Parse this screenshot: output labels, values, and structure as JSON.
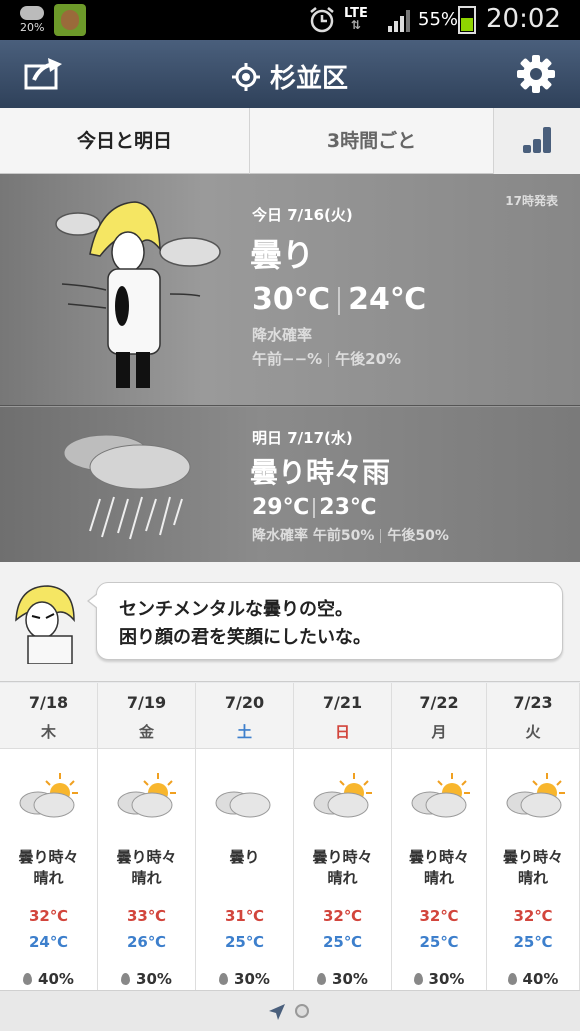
{
  "status_bar": {
    "weather_pct": "20%",
    "network": "LTE",
    "battery": "55%",
    "time": "20:02"
  },
  "header": {
    "location": "杉並区"
  },
  "tabs": [
    {
      "label": "今日と明日",
      "active": true
    },
    {
      "label": "3時間ごと",
      "active": false
    }
  ],
  "today": {
    "issued": "17時発表",
    "date": "今日 7/16(火)",
    "condition": "曇り",
    "high": "30℃",
    "low": "24℃",
    "precip_label": "降水確率",
    "precip_am": "午前−−%",
    "precip_pm": "午後20%"
  },
  "tomorrow": {
    "date": "明日 7/17(水)",
    "condition": "曇り時々雨",
    "high": "29℃",
    "low": "23℃",
    "precip_label": "降水確率",
    "precip_am": "午前50%",
    "precip_pm": "午後50%"
  },
  "message": {
    "line1": "センチメンタルな曇りの空。",
    "line2": "困り顔の君を笑顔にしたいな。"
  },
  "weekly": [
    {
      "date": "7/18",
      "weekday": "木",
      "weekday_color": "#555555",
      "cond1": "曇り時々",
      "cond2": "晴れ",
      "icon": "cloud-sun-icon",
      "high": "32℃",
      "low": "24℃",
      "rain": "40%"
    },
    {
      "date": "7/19",
      "weekday": "金",
      "weekday_color": "#555555",
      "cond1": "曇り時々",
      "cond2": "晴れ",
      "icon": "cloud-sun-icon",
      "high": "33℃",
      "low": "26℃",
      "rain": "30%"
    },
    {
      "date": "7/20",
      "weekday": "土",
      "weekday_color": "#3d7fcc",
      "cond1": "曇り",
      "cond2": "",
      "icon": "cloud-icon",
      "high": "31℃",
      "low": "25℃",
      "rain": "30%"
    },
    {
      "date": "7/21",
      "weekday": "日",
      "weekday_color": "#d2453c",
      "cond1": "曇り時々",
      "cond2": "晴れ",
      "icon": "cloud-sun-icon",
      "high": "32℃",
      "low": "25℃",
      "rain": "30%"
    },
    {
      "date": "7/22",
      "weekday": "月",
      "weekday_color": "#555555",
      "cond1": "曇り時々",
      "cond2": "晴れ",
      "icon": "cloud-sun-icon",
      "high": "32℃",
      "low": "25℃",
      "rain": "30%"
    },
    {
      "date": "7/23",
      "weekday": "火",
      "weekday_color": "#555555",
      "cond1": "曇り時々",
      "cond2": "晴れ",
      "icon": "cloud-sun-icon",
      "high": "32℃",
      "low": "25℃",
      "rain": "40%"
    }
  ]
}
